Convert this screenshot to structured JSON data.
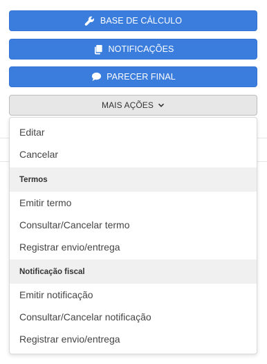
{
  "colors": {
    "primary": "#3b7ddd",
    "secondary_bg": "#e7e7e7",
    "section_bg": "#f0f0f0"
  },
  "actions": {
    "base_calculo": {
      "label": "BASE DE CÁLCULO",
      "icon": "wrench-icon"
    },
    "notificacoes": {
      "label": "NOTIFICAÇÕES",
      "icon": "copy-icon"
    },
    "parecer_final": {
      "label": "PARECER FINAL",
      "icon": "comment-icon"
    },
    "mais_acoes": {
      "label": "MAIS AÇÕES",
      "icon": "chevron-down-icon"
    }
  },
  "menu": {
    "general": [
      {
        "label": "Editar"
      },
      {
        "label": "Cancelar"
      }
    ],
    "termos": {
      "title": "Termos",
      "items": [
        {
          "label": "Emitir termo"
        },
        {
          "label": "Consultar/Cancelar termo"
        },
        {
          "label": "Registrar envio/entrega"
        }
      ]
    },
    "notificacao_fiscal": {
      "title": "Notificação fiscal",
      "items": [
        {
          "label": "Emitir notificação"
        },
        {
          "label": "Consultar/Cancelar notificação"
        },
        {
          "label": "Registrar envio/entrega"
        }
      ]
    }
  }
}
